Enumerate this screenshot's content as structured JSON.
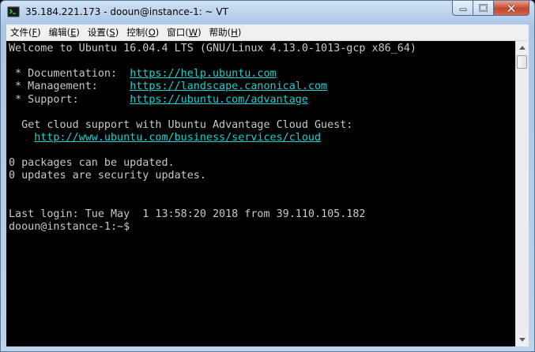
{
  "window": {
    "title": "35.184.221.173 - dooun@instance-1: ~ VT"
  },
  "menu": [
    {
      "label": "文件(",
      "key": "F",
      "suffix": ")"
    },
    {
      "label": "编辑(",
      "key": "E",
      "suffix": ")"
    },
    {
      "label": "设置(",
      "key": "S",
      "suffix": ")"
    },
    {
      "label": "控制(",
      "key": "O",
      "suffix": ")"
    },
    {
      "label": "窗口(",
      "key": "W",
      "suffix": ")"
    },
    {
      "label": "帮助(",
      "key": "H",
      "suffix": ")"
    }
  ],
  "terminal": {
    "welcome": "Welcome to Ubuntu 16.04.4 LTS (GNU/Linux 4.13.0-1013-gcp x86_64)",
    "doc_label": " * Documentation:  ",
    "doc_url": "https://help.ubuntu.com",
    "mgmt_label": " * Management:     ",
    "mgmt_url": "https://landscape.canonical.com",
    "support_label": " * Support:        ",
    "support_url": "https://ubuntu.com/advantage",
    "cloud_text": "  Get cloud support with Ubuntu Advantage Cloud Guest:",
    "cloud_indent": "    ",
    "cloud_url": "http://www.ubuntu.com/business/services/cloud",
    "packages": "0 packages can be updated.",
    "security": "0 updates are security updates.",
    "last_login": "Last login: Tue May  1 13:58:20 2018 from 39.110.105.182",
    "prompt": "dooun@instance-1:~$"
  },
  "colors": {
    "link": "#18d1d1",
    "text": "#c9c9c9",
    "background": "#000000"
  }
}
